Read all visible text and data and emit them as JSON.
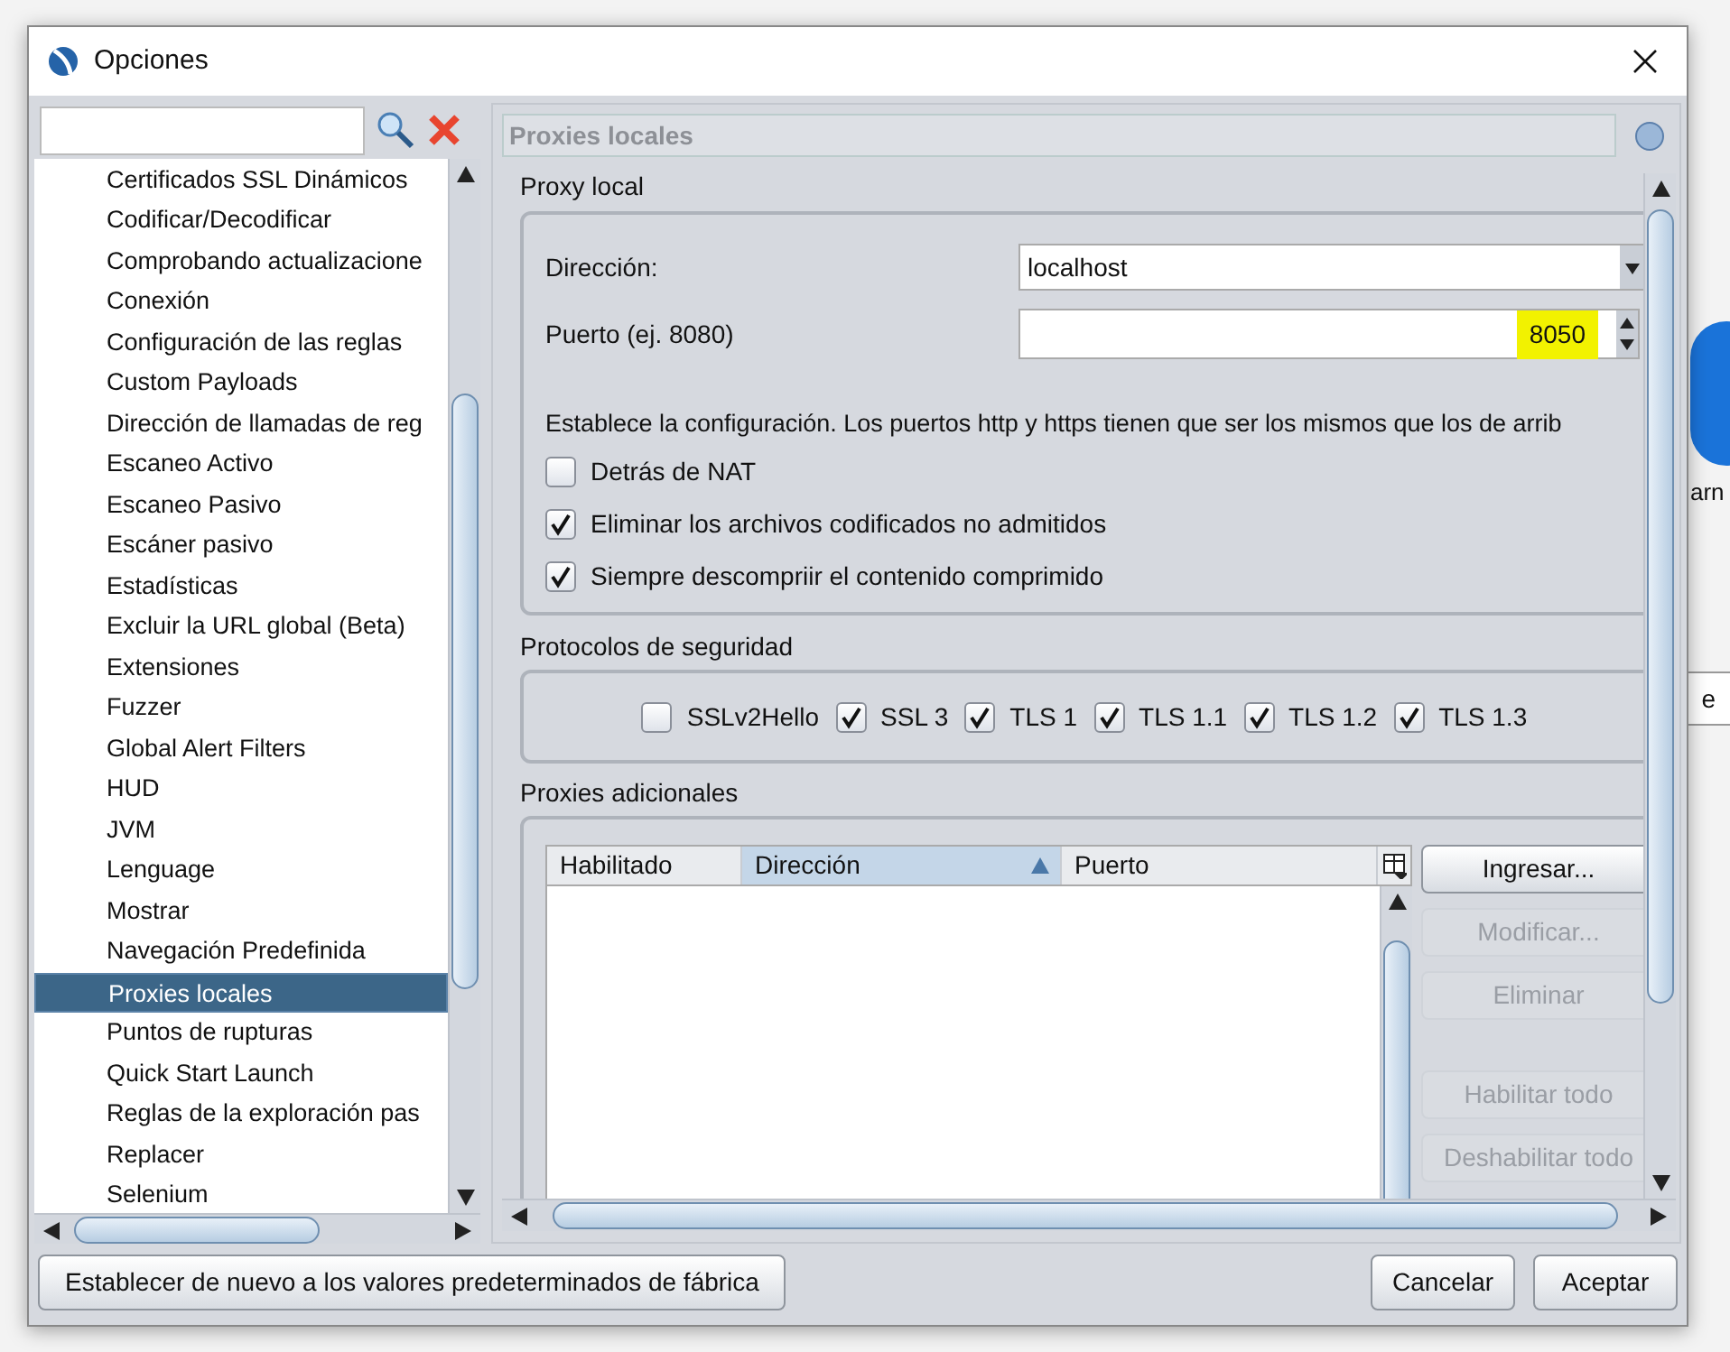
{
  "background": {
    "caption": "arn",
    "button": "e"
  },
  "window": {
    "title": "Opciones"
  },
  "sidebar": {
    "items": [
      {
        "label": "Certificados SSL Dinámicos",
        "selected": false
      },
      {
        "label": "Codificar/Decodificar",
        "selected": false
      },
      {
        "label": "Comprobando actualizacione",
        "selected": false
      },
      {
        "label": "Conexión",
        "selected": false
      },
      {
        "label": "Configuración de las reglas",
        "selected": false
      },
      {
        "label": "Custom Payloads",
        "selected": false
      },
      {
        "label": "Dirección de llamadas de reg",
        "selected": false
      },
      {
        "label": "Escaneo Activo",
        "selected": false
      },
      {
        "label": "Escaneo Pasivo",
        "selected": false
      },
      {
        "label": "Escáner pasivo",
        "selected": false
      },
      {
        "label": "Estadísticas",
        "selected": false
      },
      {
        "label": "Excluir la URL global (Beta)",
        "selected": false
      },
      {
        "label": "Extensiones",
        "selected": false
      },
      {
        "label": "Fuzzer",
        "selected": false
      },
      {
        "label": "Global Alert Filters",
        "selected": false
      },
      {
        "label": "HUD",
        "selected": false
      },
      {
        "label": "JVM",
        "selected": false
      },
      {
        "label": "Lenguage",
        "selected": false
      },
      {
        "label": "Mostrar",
        "selected": false
      },
      {
        "label": "Navegación Predefinida",
        "selected": false
      },
      {
        "label": "Proxies locales",
        "selected": true
      },
      {
        "label": "Puntos de rupturas",
        "selected": false
      },
      {
        "label": "Quick Start Launch",
        "selected": false
      },
      {
        "label": "Reglas de la exploración pas",
        "selected": false
      },
      {
        "label": "Replacer",
        "selected": false
      },
      {
        "label": "Selenium",
        "selected": false
      }
    ]
  },
  "panel": {
    "title": "Proxies locales",
    "proxy_local": {
      "title": "Proxy local",
      "address_label": "Dirección:",
      "address_value": "localhost",
      "port_label": "Puerto (ej. 8080)",
      "port_value": "8050",
      "description": "Establece la configuración. Los puertos http y https tienen que ser los mismos que los de arrib",
      "options": [
        {
          "label": "Detrás de NAT",
          "checked": false
        },
        {
          "label": "Eliminar los archivos codificados no admitidos",
          "checked": true
        },
        {
          "label": "Siempre descompriir el contenido comprimido",
          "checked": true
        }
      ]
    },
    "security": {
      "title": "Protocolos de seguridad",
      "protocols": [
        {
          "label": "SSLv2Hello",
          "checked": false
        },
        {
          "label": "SSL 3",
          "checked": true
        },
        {
          "label": "TLS 1",
          "checked": true
        },
        {
          "label": "TLS 1.1",
          "checked": true
        },
        {
          "label": "TLS 1.2",
          "checked": true
        },
        {
          "label": "TLS 1.3",
          "checked": true
        }
      ]
    },
    "additional": {
      "title": "Proxies adicionales",
      "columns": [
        {
          "label": "Habilitado",
          "sorted": false
        },
        {
          "label": "Dirección",
          "sorted": true
        },
        {
          "label": "Puerto",
          "sorted": false
        }
      ],
      "buttons": [
        {
          "label": "Ingresar...",
          "disabled": false
        },
        {
          "label": "Modificar...",
          "disabled": true
        },
        {
          "label": "Eliminar",
          "disabled": true
        },
        {
          "label": "Habilitar todo",
          "disabled": true
        },
        {
          "label": "Deshabilitar todo",
          "disabled": true
        }
      ]
    }
  },
  "footer": {
    "reset": "Establecer de nuevo a los valores predeterminados de fábrica",
    "buttons": [
      "Cancelar",
      "Aceptar"
    ]
  }
}
